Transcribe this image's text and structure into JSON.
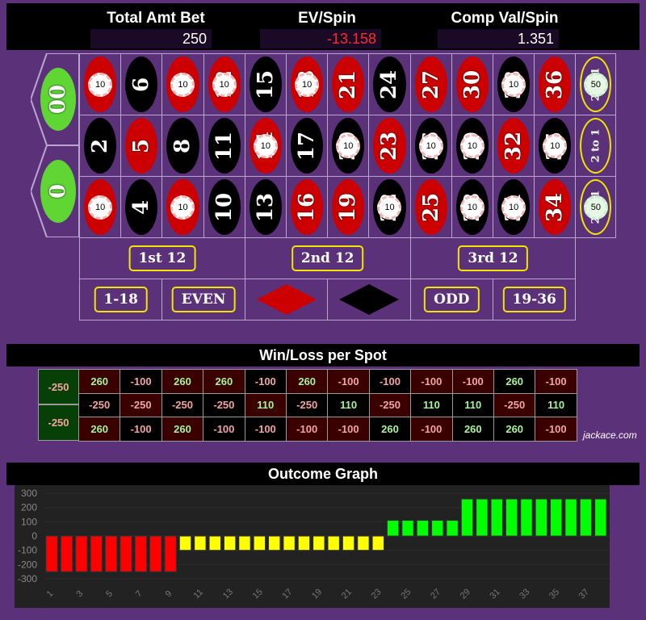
{
  "header": {
    "total_label": "Total Amt Bet",
    "total_value": "250",
    "ev_label": "EV/Spin",
    "ev_value": "-13.158",
    "comp_label": "Comp Val/Spin",
    "comp_value": "1.351"
  },
  "colors": {
    "felt": "#5b317a",
    "red": "#cc0000",
    "black": "#000000",
    "green": "#5fd633",
    "ev_negative": "#ff2a2a"
  },
  "board": {
    "zeros": [
      "00",
      "0"
    ],
    "rows": [
      [
        3,
        6,
        9,
        12,
        15,
        18,
        21,
        24,
        27,
        30,
        33,
        36
      ],
      [
        2,
        5,
        8,
        11,
        14,
        17,
        20,
        23,
        26,
        29,
        32,
        35
      ],
      [
        1,
        4,
        7,
        10,
        13,
        16,
        19,
        22,
        25,
        28,
        31,
        34
      ]
    ],
    "red_numbers": [
      1,
      3,
      5,
      7,
      9,
      12,
      14,
      16,
      18,
      19,
      21,
      23,
      25,
      27,
      30,
      32,
      34,
      36
    ],
    "chips": {
      "3": "10",
      "9": "10",
      "12": "10",
      "18": "10",
      "33": "10",
      "14": "10",
      "20": "10",
      "26": "10",
      "29": "10",
      "35": "10",
      "1": "10",
      "7": "10",
      "22": "10",
      "28": "10",
      "31": "10"
    },
    "columns": [
      {
        "label": "2 to 1",
        "chip": "50"
      },
      {
        "label": "2 to 1",
        "chip": ""
      },
      {
        "label": "2 to 1",
        "chip": "50"
      }
    ],
    "dozens": [
      "1st 12",
      "2nd 12",
      "3rd 12"
    ],
    "outside": [
      "1-18",
      "EVEN",
      "red-diamond",
      "black-diamond",
      "ODD",
      "19-36"
    ]
  },
  "winloss": {
    "title": "Win/Loss per Spot",
    "zeros": [
      "-250",
      "-250"
    ],
    "rows": [
      [
        "260",
        "-100",
        "260",
        "260",
        "-100",
        "260",
        "-100",
        "-100",
        "-100",
        "-100",
        "260",
        "-100"
      ],
      [
        "-250",
        "-250",
        "-250",
        "-250",
        "110",
        "-250",
        "110",
        "-250",
        "110",
        "110",
        "-250",
        "110"
      ],
      [
        "260",
        "-100",
        "260",
        "-100",
        "-100",
        "-100",
        "-100",
        "260",
        "-100",
        "260",
        "260",
        "-100"
      ]
    ],
    "credit": "jackace.com"
  },
  "chart_data": {
    "type": "bar",
    "title": "Outcome Graph",
    "x": [
      1,
      2,
      3,
      4,
      5,
      6,
      7,
      8,
      9,
      10,
      11,
      12,
      13,
      14,
      15,
      16,
      17,
      18,
      19,
      20,
      21,
      22,
      23,
      24,
      25,
      26,
      27,
      28,
      29,
      30,
      31,
      32,
      33,
      34,
      35,
      36,
      37,
      38
    ],
    "values": [
      -250,
      -250,
      -250,
      -250,
      -250,
      -250,
      -250,
      -250,
      -250,
      -100,
      -100,
      -100,
      -100,
      -100,
      -100,
      -100,
      -100,
      -100,
      -100,
      -100,
      -100,
      -100,
      -100,
      110,
      110,
      110,
      110,
      110,
      260,
      260,
      260,
      260,
      260,
      260,
      260,
      260,
      260,
      260
    ],
    "ylim": [
      -300,
      300
    ],
    "yticks": [
      300,
      200,
      100,
      0,
      -100,
      -200,
      -300
    ],
    "xticks": [
      1,
      3,
      5,
      7,
      9,
      11,
      13,
      15,
      17,
      19,
      21,
      23,
      25,
      27,
      29,
      31,
      33,
      35,
      37
    ],
    "grid": true,
    "bar_colors": {
      "loss_all": "#ff0000",
      "loss_partial": "#ffff00",
      "win": "#00ff00"
    }
  }
}
